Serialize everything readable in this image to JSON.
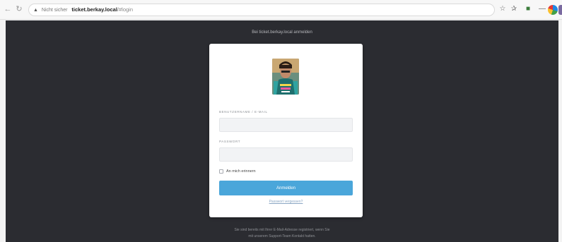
{
  "browser": {
    "security_label": "Nicht sicher",
    "url_host": "ticket.berkay.local",
    "url_path": "/#login"
  },
  "page": {
    "heading": "Bei ticket.berkay.local anmelden"
  },
  "login": {
    "username_label": "Benutzername / E-Mail",
    "username_value": "",
    "password_label": "Passwort",
    "password_value": "",
    "remember_label": "An mich erinnern",
    "submit_label": "Anmelden",
    "forgot_label": "Passwort vergessen?"
  },
  "footer": {
    "line1": "Sie sind bereits mit Ihrer E-Mail-Adresse registriert, wenn Sie",
    "line2": "mit unserem Support-Team Kontakt hatten."
  },
  "colors": {
    "page_background": "#2b2c31",
    "button": "#4aa6da",
    "link": "#8aa6c3"
  }
}
